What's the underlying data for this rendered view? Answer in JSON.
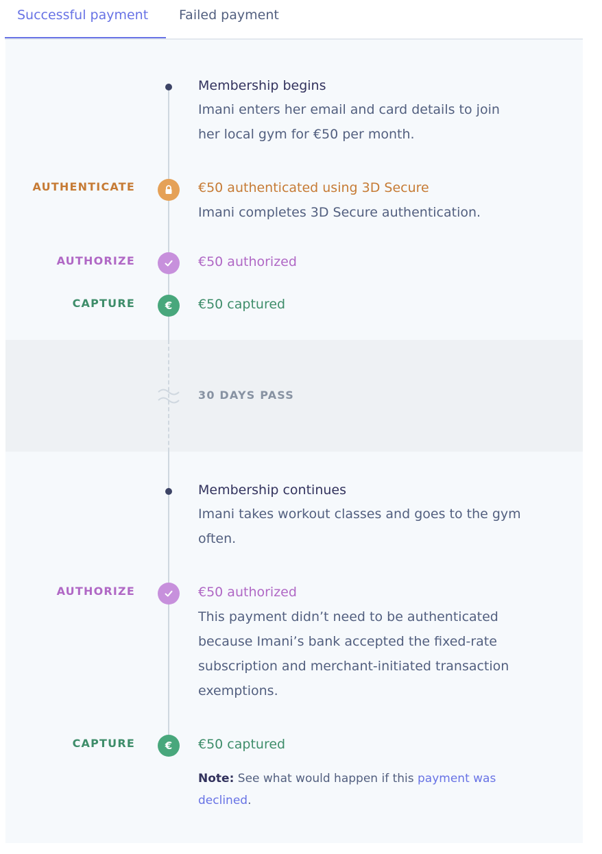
{
  "tabs": [
    {
      "label": "Successful payment",
      "active": true
    },
    {
      "label": "Failed payment",
      "active": false
    }
  ],
  "timeline": {
    "membership_begins": {
      "title": "Membership begins",
      "description": "Imani enters her email and card details to join her local gym for €50 per month."
    },
    "authenticate": {
      "stage": "AUTHENTICATE",
      "icon": "lock-icon",
      "title": "€50 authenticated using 3D Secure",
      "description": "Imani completes 3D Secure authentication."
    },
    "authorize_1": {
      "stage": "AUTHORIZE",
      "icon": "check-icon",
      "title": "€50 authorized"
    },
    "capture_1": {
      "stage": "CAPTURE",
      "icon": "euro-icon",
      "icon_glyph": "€",
      "title": "€50 captured"
    },
    "time_gap": {
      "label": "30 DAYS PASS"
    },
    "membership_continues": {
      "title": "Membership continues",
      "description": "Imani takes workout classes and goes to the gym often."
    },
    "authorize_2": {
      "stage": "AUTHORIZE",
      "icon": "check-icon",
      "title": "€50 authorized",
      "description": "This payment didn’t need to be authenticated because Imani’s bank accepted the fixed-rate subscription and merchant-initiated transaction exemptions."
    },
    "capture_2": {
      "stage": "CAPTURE",
      "icon": "euro-icon",
      "icon_glyph": "€",
      "title": "€50 captured"
    }
  },
  "note": {
    "label": "Note:",
    "text": " See what would happen if this ",
    "link_text": "payment was declined",
    "suffix": "."
  },
  "colors": {
    "accent": "#6772e5",
    "authenticate": "#e5a157",
    "authorize": "#c790dc",
    "capture": "#48a77c"
  }
}
